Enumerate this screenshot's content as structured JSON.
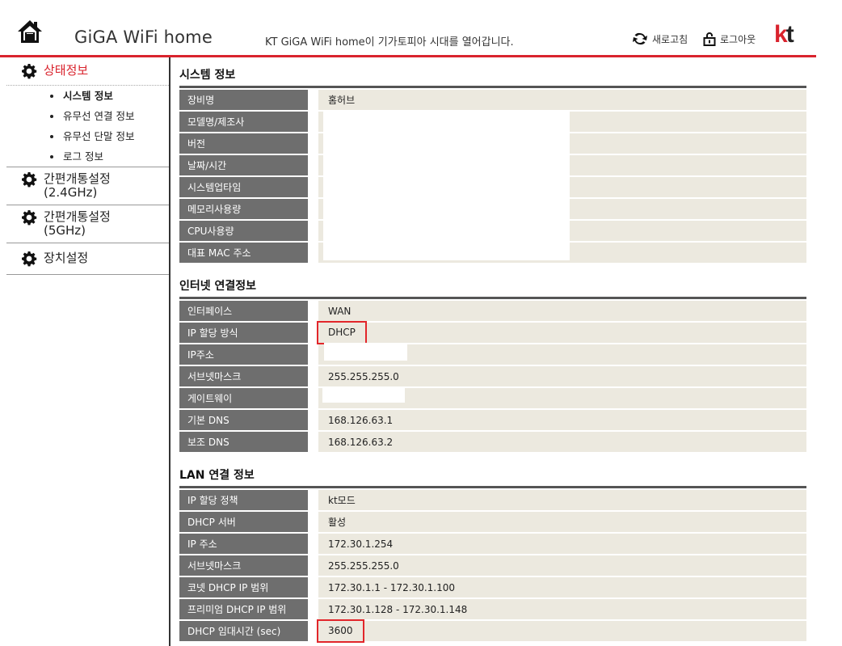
{
  "header": {
    "brand": "GiGA WiFi home",
    "slogan": "KT GiGA WiFi home이 기가토피아 시대를 열어갑니다.",
    "refresh_label": "새로고침",
    "logout_label": "로그아웃",
    "logo_k": "k",
    "logo_t": "t"
  },
  "sidebar": {
    "groups": [
      {
        "label": "상태정보",
        "items": [
          "시스템 정보",
          "유무선 연결 정보",
          "유무선 단말 정보",
          "로그 정보"
        ]
      },
      {
        "label_line1": "간편개통설정",
        "label_line2": "(2.4GHz)"
      },
      {
        "label_line1": "간편개통설정",
        "label_line2": "(5GHz)"
      },
      {
        "label": "장치설정"
      }
    ]
  },
  "system": {
    "title": "시스템 정보",
    "rows": [
      {
        "k": "장비명",
        "v": "홈허브"
      },
      {
        "k": "모델명/제조사",
        "v": ""
      },
      {
        "k": "버전",
        "v": ""
      },
      {
        "k": "날짜/시간",
        "v": ""
      },
      {
        "k": "시스템업타임",
        "v": ""
      },
      {
        "k": "메모리사용량",
        "v": ""
      },
      {
        "k": "CPU사용량",
        "v": ""
      },
      {
        "k": "대표 MAC 주소",
        "v": ""
      }
    ]
  },
  "internet": {
    "title": "인터넷 연결정보",
    "rows": [
      {
        "k": "인터페이스",
        "v": "WAN"
      },
      {
        "k": "IP 할당 방식",
        "v": "DHCP"
      },
      {
        "k": "IP주소",
        "v": ""
      },
      {
        "k": "서브넷마스크",
        "v": "255.255.255.0"
      },
      {
        "k": "게이트웨이",
        "v": ""
      },
      {
        "k": "기본 DNS",
        "v": "168.126.63.1"
      },
      {
        "k": "보조 DNS",
        "v": "168.126.63.2"
      }
    ]
  },
  "lan": {
    "title": "LAN 연결 정보",
    "rows": [
      {
        "k": "IP 할당 정책",
        "v": "kt모드"
      },
      {
        "k": "DHCP 서버",
        "v": "활성"
      },
      {
        "k": "IP 주소",
        "v": "172.30.1.254"
      },
      {
        "k": "서브넷마스크",
        "v": "255.255.255.0"
      },
      {
        "k": "코넷 DHCP IP 범위",
        "v": "172.30.1.1 - 172.30.1.100"
      },
      {
        "k": "프리미엄 DHCP IP 범위",
        "v": "172.30.1.128 - 172.30.1.148"
      },
      {
        "k": "DHCP 임대시간 (sec)",
        "v": "3600"
      }
    ]
  },
  "colors": {
    "accent": "#d9232d",
    "key_bg": "#6e6e6e",
    "value_bg": "#ece9df"
  }
}
